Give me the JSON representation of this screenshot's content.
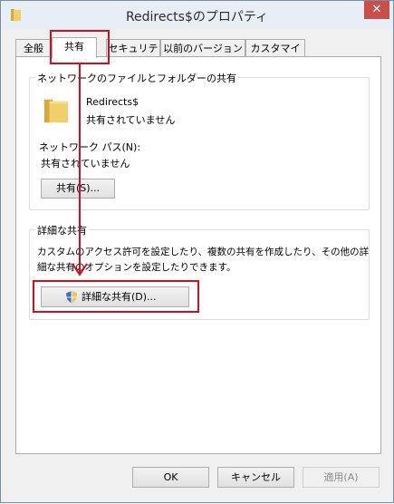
{
  "window": {
    "title": "Redirects$のプロパティ",
    "close_glyph": "✕"
  },
  "tabs": [
    {
      "label": "全般"
    },
    {
      "label": "共有"
    },
    {
      "label": "セキュリティ"
    },
    {
      "label": "以前のバージョン"
    },
    {
      "label": "カスタマイズ"
    }
  ],
  "network_share": {
    "group_label": "ネットワークのファイルとフォルダーの共有",
    "folder_name": "Redirects$",
    "folder_status": "共有されていません",
    "path_label": "ネットワーク パス(N):",
    "path_value": "共有されていません",
    "share_button": "共有(S)..."
  },
  "advanced_share": {
    "group_label": "詳細な共有",
    "description_line1": "カスタムのアクセス許可を設定したり、複数の共有を作成したり、その他の詳",
    "description_line2": "細な共有のオプションを設定したりできます。",
    "button": "詳細な共有(D)...",
    "button_icon": "uac-shield-icon"
  },
  "footer": {
    "ok": "OK",
    "cancel": "キャンセル",
    "apply": "適用(A)"
  },
  "colors": {
    "highlight": "#d01020",
    "folder": "#e8c25a"
  }
}
